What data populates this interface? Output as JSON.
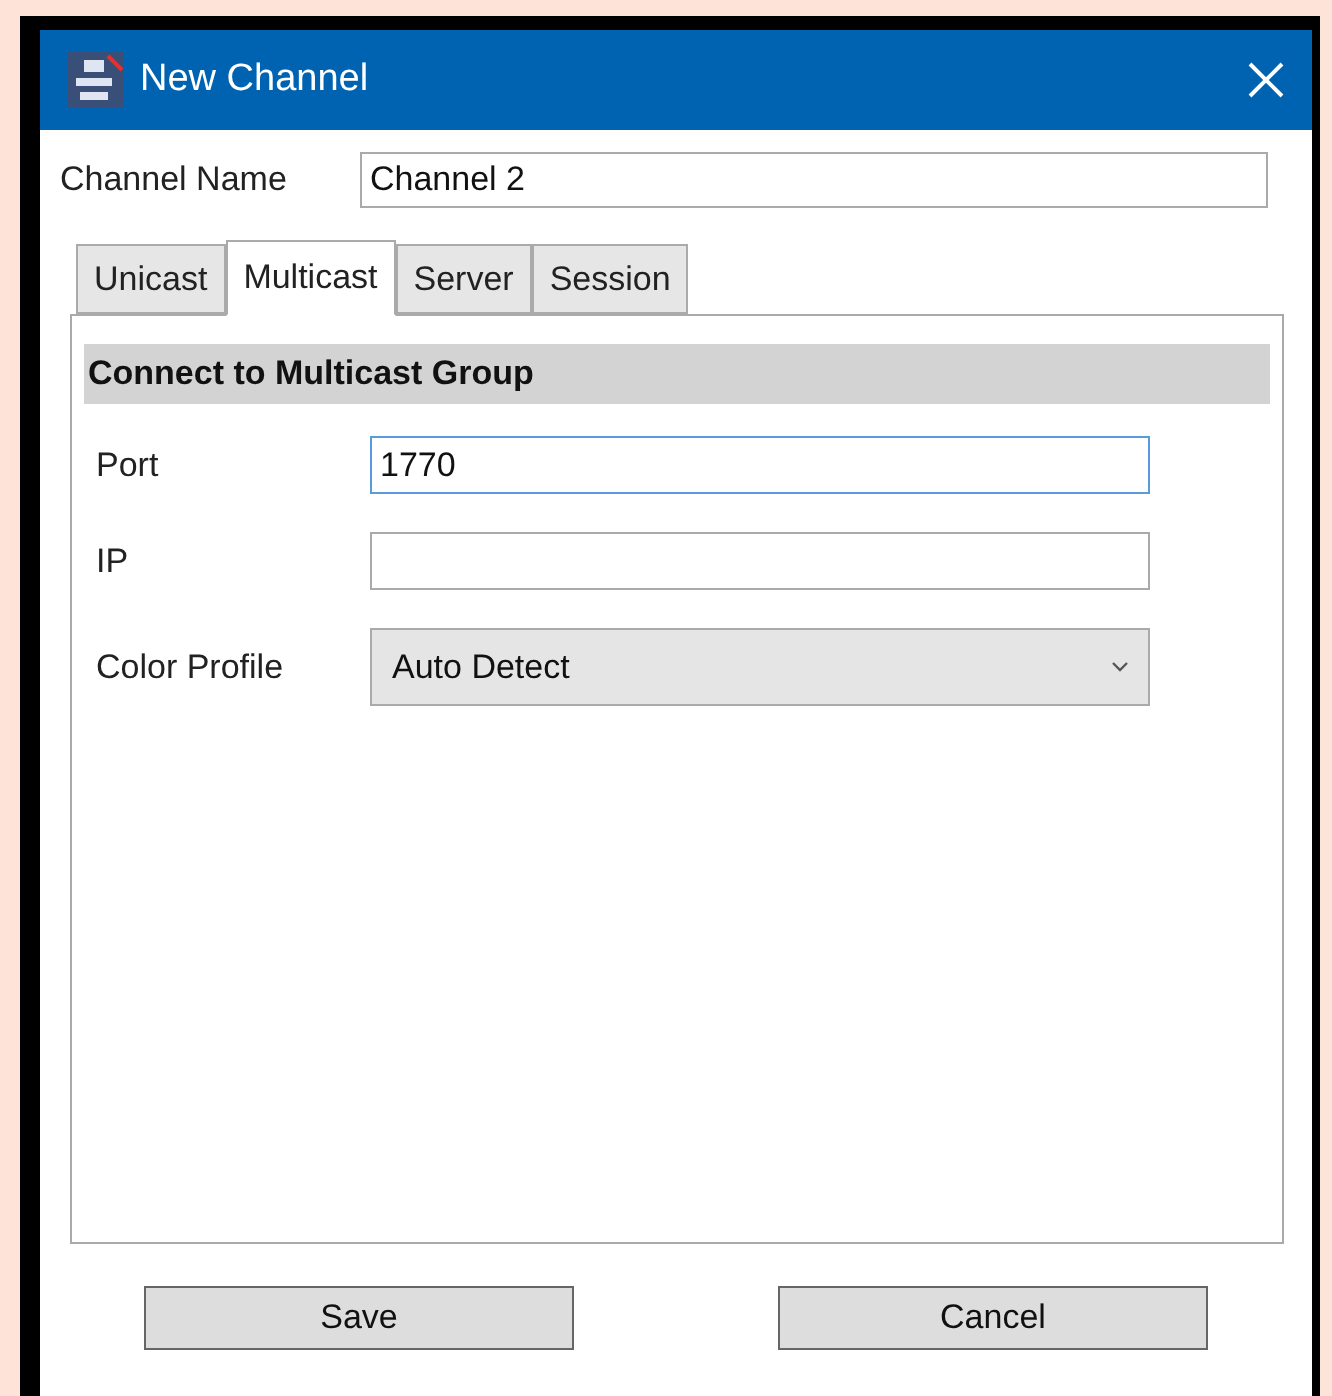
{
  "window": {
    "title": "New Channel"
  },
  "channel_name": {
    "label": "Channel Name",
    "value": "Channel 2"
  },
  "tabs": [
    {
      "label": "Unicast",
      "selected": false
    },
    {
      "label": "Multicast",
      "selected": true
    },
    {
      "label": "Server",
      "selected": false
    },
    {
      "label": "Session",
      "selected": false
    }
  ],
  "section": {
    "title": "Connect to Multicast Group"
  },
  "fields": [
    {
      "kind": "text",
      "label": "Port",
      "value": "1770",
      "focused": true
    },
    {
      "kind": "text",
      "label": "IP",
      "focused": false
    },
    {
      "kind": "dropdown",
      "label": "Color Profile",
      "value": "Auto Detect",
      "focused": false
    }
  ],
  "buttons": [
    "Save",
    "Cancel"
  ]
}
